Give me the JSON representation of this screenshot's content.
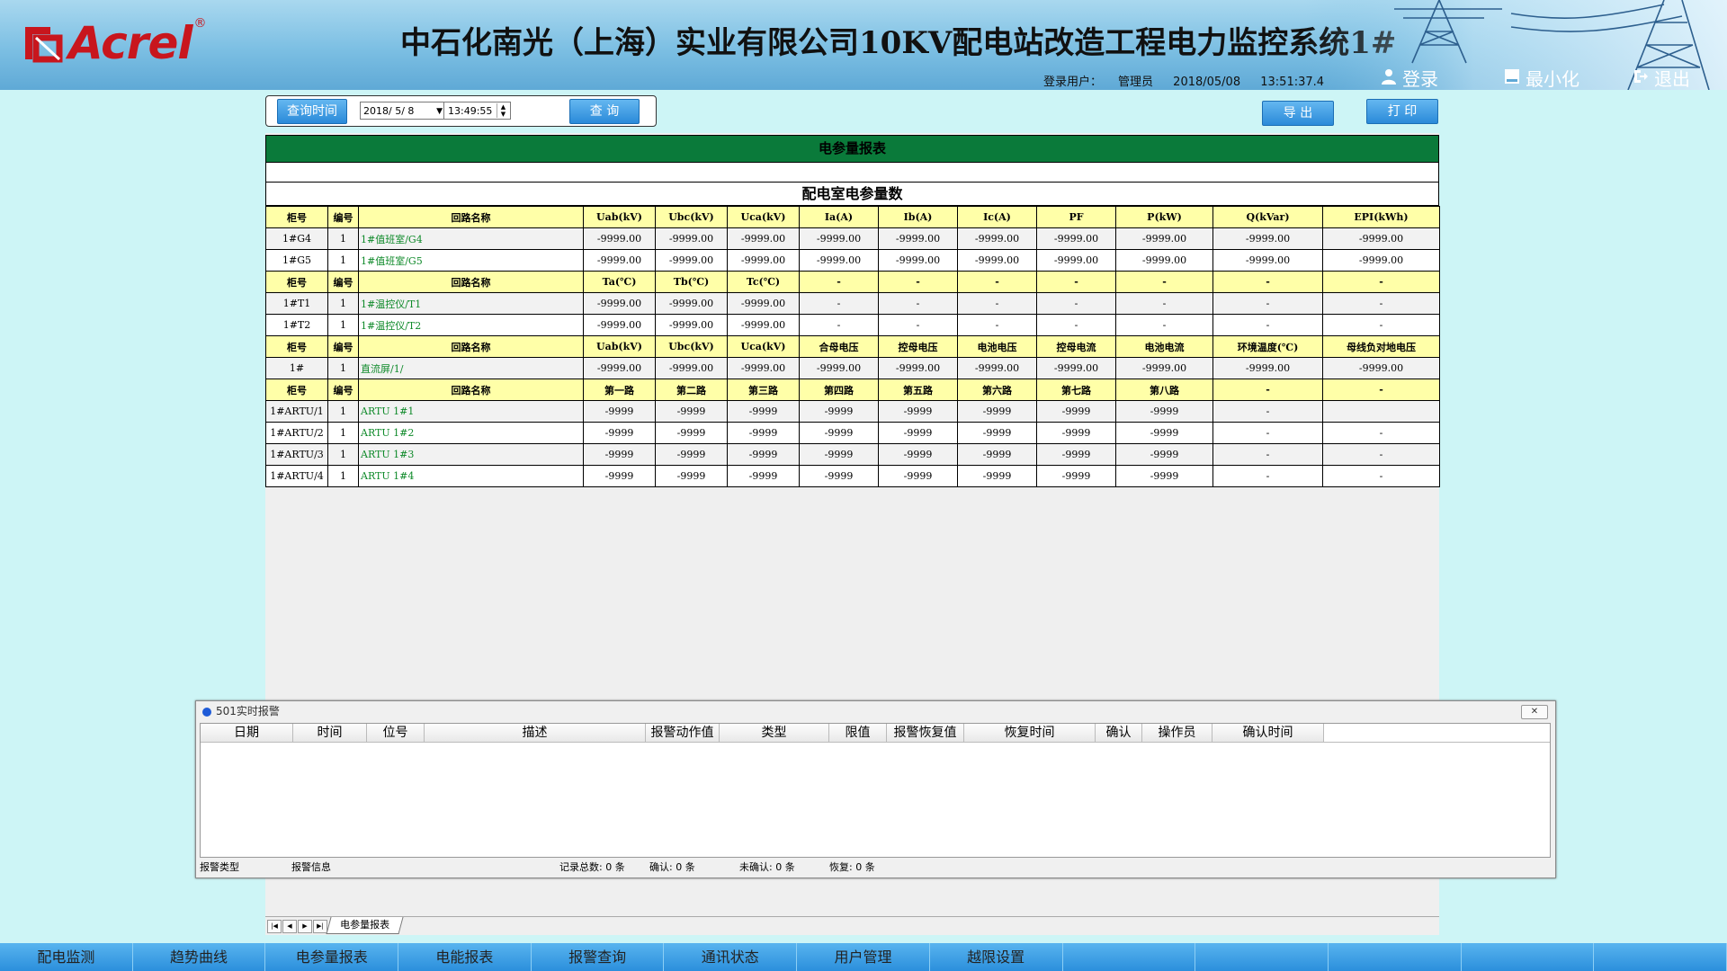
{
  "header": {
    "logo_text": "Acrel",
    "logo_reg": "®",
    "title": "中石化南光（上海）实业有限公司10KV配电站改造工程电力监控系统1#",
    "user_label": "登录用户：",
    "user_name": "管理员",
    "date": "2018/05/08",
    "time": "13:51:37.4",
    "login_label": "登录",
    "minimize_label": "最小化",
    "logout_label": "退出"
  },
  "query": {
    "time_label": "查询时间",
    "date_value": "2018/ 5/ 8",
    "time_value": "13:49:55",
    "query_label": "查 询",
    "export_label": "导 出",
    "print_label": "打 印"
  },
  "report": {
    "header": "电参量报表",
    "subtitle": "配电室电参量数",
    "sections": [
      {
        "headers": [
          "柜号",
          "编号",
          "回路名称",
          "Uab(kV)",
          "Ubc(kV)",
          "Uca(kV)",
          "Ia(A)",
          "Ib(A)",
          "Ic(A)",
          "PF",
          "P(kW)",
          "Q(kVar)",
          "EPI(kWh)"
        ],
        "rows": [
          [
            "1#G4",
            "1",
            "1#值班室/G4",
            "-9999.00",
            "-9999.00",
            "-9999.00",
            "-9999.00",
            "-9999.00",
            "-9999.00",
            "-9999.00",
            "-9999.00",
            "-9999.00",
            "-9999.00"
          ],
          [
            "1#G5",
            "1",
            "1#值班室/G5",
            "-9999.00",
            "-9999.00",
            "-9999.00",
            "-9999.00",
            "-9999.00",
            "-9999.00",
            "-9999.00",
            "-9999.00",
            "-9999.00",
            "-9999.00"
          ]
        ]
      },
      {
        "headers": [
          "柜号",
          "编号",
          "回路名称",
          "Ta(℃)",
          "Tb(℃)",
          "Tc(℃)",
          "-",
          "-",
          "-",
          "-",
          "-",
          "-",
          "-"
        ],
        "rows": [
          [
            "1#T1",
            "1",
            "1#温控仪/T1",
            "-9999.00",
            "-9999.00",
            "-9999.00",
            "-",
            "-",
            "-",
            "-",
            "-",
            "-",
            "-"
          ],
          [
            "1#T2",
            "1",
            "1#温控仪/T2",
            "-9999.00",
            "-9999.00",
            "-9999.00",
            "-",
            "-",
            "-",
            "-",
            "-",
            "-",
            "-"
          ]
        ]
      },
      {
        "headers": [
          "柜号",
          "编号",
          "回路名称",
          "Uab(kV)",
          "Ubc(kV)",
          "Uca(kV)",
          "合母电压",
          "控母电压",
          "电池电压",
          "控母电流",
          "电池电流",
          "环境温度(℃)",
          "母线负对地电压"
        ],
        "rows": [
          [
            "1#",
            "1",
            "直流屏/1/",
            "-9999.00",
            "-9999.00",
            "-9999.00",
            "-9999.00",
            "-9999.00",
            "-9999.00",
            "-9999.00",
            "-9999.00",
            "-9999.00",
            "-9999.00"
          ]
        ]
      },
      {
        "headers": [
          "柜号",
          "编号",
          "回路名称",
          "第一路",
          "第二路",
          "第三路",
          "第四路",
          "第五路",
          "第六路",
          "第七路",
          "第八路",
          "-",
          "-"
        ],
        "rows": [
          [
            "1#ARTU/1",
            "1",
            "ARTU 1#1",
            "-9999",
            "-9999",
            "-9999",
            "-9999",
            "-9999",
            "-9999",
            "-9999",
            "-9999",
            "-",
            ""
          ],
          [
            "1#ARTU/2",
            "1",
            "ARTU 1#2",
            "-9999",
            "-9999",
            "-9999",
            "-9999",
            "-9999",
            "-9999",
            "-9999",
            "-9999",
            "-",
            "-"
          ],
          [
            "1#ARTU/3",
            "1",
            "ARTU 1#3",
            "-9999",
            "-9999",
            "-9999",
            "-9999",
            "-9999",
            "-9999",
            "-9999",
            "-9999",
            "-",
            "-"
          ],
          [
            "1#ARTU/4",
            "1",
            "ARTU 1#4",
            "-9999",
            "-9999",
            "-9999",
            "-9999",
            "-9999",
            "-9999",
            "-9999",
            "-9999",
            "-",
            "-"
          ]
        ]
      }
    ]
  },
  "alarm": {
    "title": "501实时报警",
    "columns": [
      "日期",
      "时间",
      "位号",
      "描述",
      "报警动作值",
      "类型",
      "限值",
      "报警恢复值",
      "恢复时间",
      "确认",
      "操作员",
      "确认时间"
    ],
    "status": {
      "type_label": "报警类型",
      "info_label": "报警信息",
      "total": "记录总数: 0 条",
      "confirmed": "确认: 0 条",
      "unconfirmed": "未确认: 0 条",
      "recovered": "恢复: 0 条"
    }
  },
  "sheet": {
    "tab_label": "电参量报表"
  },
  "bottom_nav": [
    "配电监测",
    "趋势曲线",
    "电参量报表",
    "电能报表",
    "报警查询",
    "通讯状态",
    "用户管理",
    "越限设置",
    "",
    "",
    "",
    "",
    ""
  ],
  "colors": {
    "accent": "#2a8ad9",
    "report_header": "#0a7a3a",
    "table_header": "#ffffa8",
    "logo": "#c8161d"
  }
}
